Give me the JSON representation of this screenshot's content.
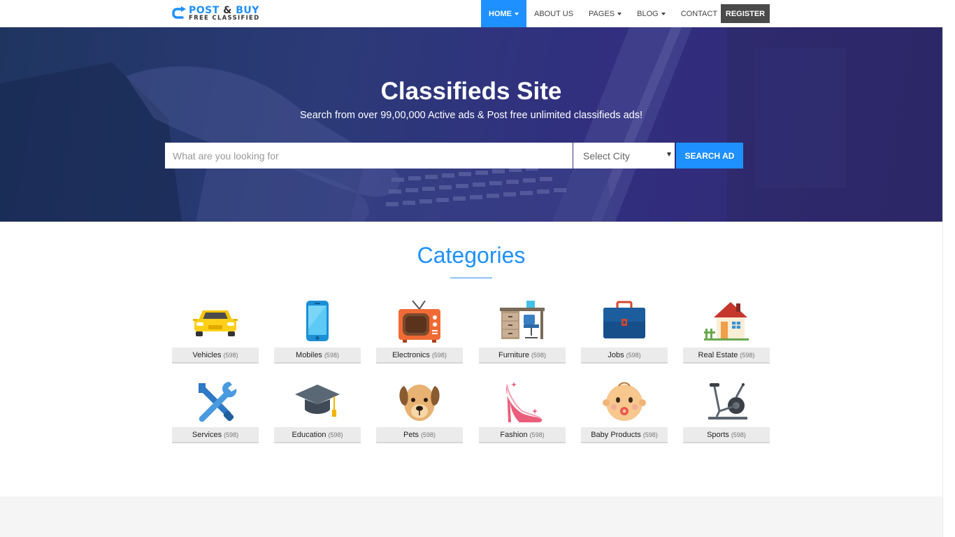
{
  "logo": {
    "line1_a": "POST",
    "line1_amp": "&",
    "line1_b": "BUY",
    "line2": "FREE CLASSIFIED"
  },
  "nav": {
    "items": [
      {
        "label": "HOME",
        "has_caret": true,
        "active": true
      },
      {
        "label": "ABOUT US",
        "has_caret": false,
        "active": false
      },
      {
        "label": "PAGES",
        "has_caret": true,
        "active": false
      },
      {
        "label": "BLOG",
        "has_caret": true,
        "active": false
      },
      {
        "label": "CONTACT",
        "has_caret": false,
        "active": false
      }
    ],
    "register_label": "REGISTER"
  },
  "hero": {
    "title": "Classifieds Site",
    "subtitle": "Search from over 99,00,000 Active ads & Post free unlimited classifieds ads!",
    "search_placeholder": "What are you looking for",
    "city_selected": "Select City",
    "search_button": "SEARCH AD"
  },
  "categories": {
    "title": "Categories",
    "items": [
      {
        "name": "Vehicles",
        "count": "(598)",
        "icon": "car-icon"
      },
      {
        "name": "Mobiles",
        "count": "(598)",
        "icon": "mobile-phone-icon"
      },
      {
        "name": "Electronics",
        "count": "(598)",
        "icon": "tv-icon"
      },
      {
        "name": "Furniture",
        "count": "(598)",
        "icon": "desk-chair-icon"
      },
      {
        "name": "Jobs",
        "count": "(598)",
        "icon": "briefcase-icon"
      },
      {
        "name": "Real Estate",
        "count": "(598)",
        "icon": "house-icon"
      },
      {
        "name": "Services",
        "count": "(598)",
        "icon": "wrench-screwdriver-icon"
      },
      {
        "name": "Education",
        "count": "(598)",
        "icon": "graduation-cap-icon"
      },
      {
        "name": "Pets",
        "count": "(598)",
        "icon": "dog-icon"
      },
      {
        "name": "Fashion",
        "count": "(598)",
        "icon": "high-heel-icon"
      },
      {
        "name": "Baby Products",
        "count": "(598)",
        "icon": "baby-face-icon"
      },
      {
        "name": "Sports",
        "count": "(598)",
        "icon": "exercise-bike-icon"
      }
    ]
  },
  "colors": {
    "accent": "#1e90ff",
    "register_bg": "#4a4a4a",
    "hero_overlay": "#2c3a78"
  }
}
